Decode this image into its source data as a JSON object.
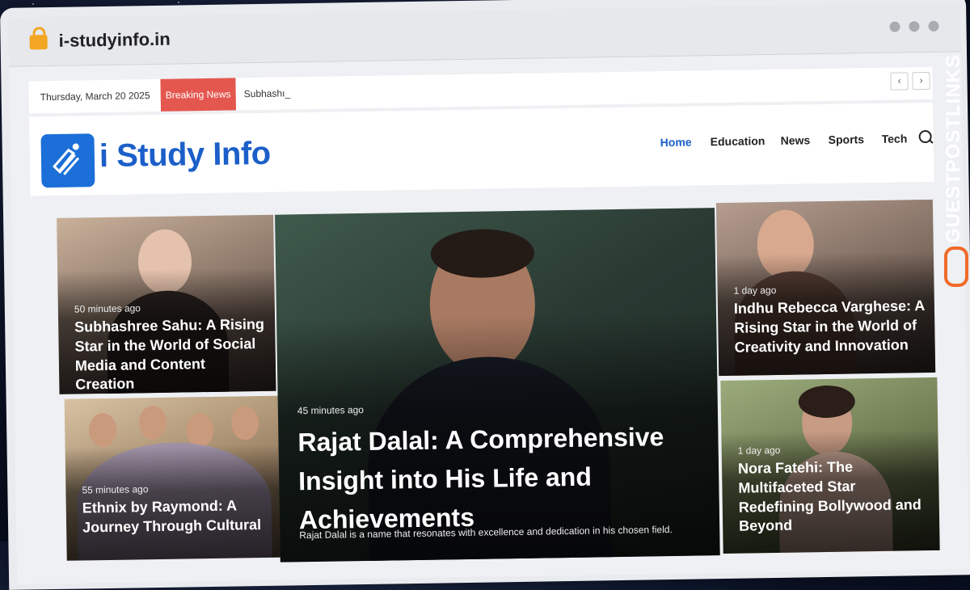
{
  "browser": {
    "url": "i-studyinfo.in"
  },
  "topbar": {
    "date": "Thursday, March 20 2025",
    "breaking_label": "Breaking News",
    "ticker": "Subhashı_",
    "prev": "‹",
    "next": "›"
  },
  "header": {
    "logo_text": "i Study Info",
    "nav": [
      "Home",
      "Education",
      "News",
      "Sports",
      "Tech"
    ]
  },
  "cards": [
    {
      "time": "50 minutes ago",
      "title": "Subhashree Sahu: A Rising Star in the World of Social Media and Content Creation"
    },
    {
      "time": "55 minutes ago",
      "title": "Ethnix by Raymond: A Journey Through Cultural"
    },
    {
      "time": "45 minutes ago",
      "title": "Rajat Dalal: A Comprehensive Insight into His Life and Achievements",
      "excerpt": "Rajat Dalal is a name that resonates with excellence and dedication in his chosen field."
    },
    {
      "time": "1 day ago",
      "title": "Indhu Rebecca Varghese: A Rising Star in the World of Creativity and Innovation"
    },
    {
      "time": "1 day ago",
      "title": "Nora Fatehi: The Multifaceted Star Redefining Bollywood and Beyond"
    }
  ],
  "brand": {
    "label": "GUESTPOSTLINKS"
  },
  "colors": {
    "accent": "#1c5fc9",
    "breaking": "#e4574f",
    "brand": "#f06a2a"
  }
}
